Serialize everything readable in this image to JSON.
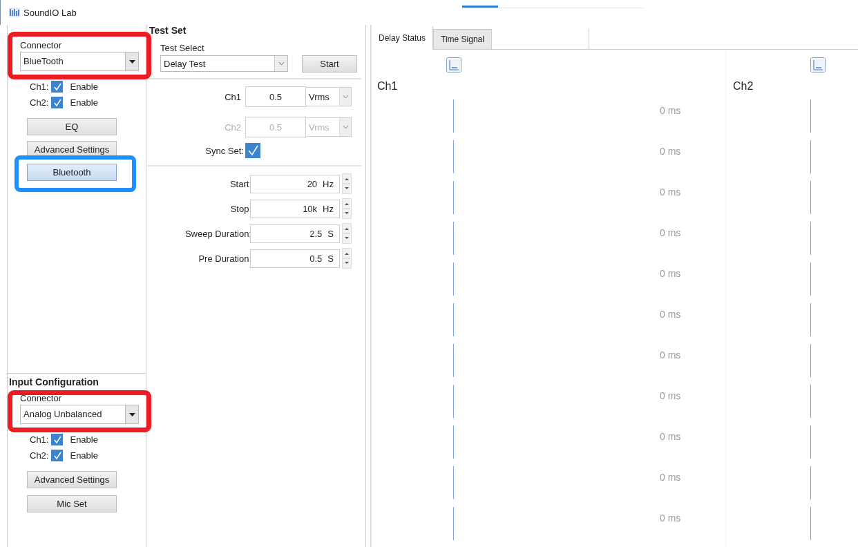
{
  "window": {
    "title": "SoundIO Lab"
  },
  "output": {
    "connector": {
      "label": "Connector",
      "value": "BlueTooth",
      "highlighted": true
    },
    "channels": [
      {
        "label": "Ch1:",
        "text": "Enable",
        "checked": true
      },
      {
        "label": "Ch2:",
        "text": "Enable",
        "checked": true
      }
    ],
    "buttons": [
      {
        "label": "EQ"
      },
      {
        "label": "Advanced Settings"
      },
      {
        "label": "Bluetooth",
        "highlighted": true
      }
    ]
  },
  "input": {
    "title": "Input Configuration",
    "connector": {
      "label": "Connector",
      "value": "Analog Unbalanced",
      "highlighted": true
    },
    "channels": [
      {
        "label": "Ch1:",
        "text": "Enable",
        "checked": true
      },
      {
        "label": "Ch2:",
        "text": "Enable",
        "checked": true
      }
    ],
    "buttons": [
      {
        "label": "Advanced Settings"
      },
      {
        "label": "Mic Set"
      }
    ]
  },
  "test_set": {
    "title": "Test Set",
    "select_label": "Test Select",
    "select_value": "Delay Test",
    "start_button": "Start",
    "levels": [
      {
        "label": "Ch1",
        "value": "0.5",
        "unit": "Vrms",
        "disabled": false
      },
      {
        "label": "Ch2",
        "value": "0.5",
        "unit": "Vrms",
        "disabled": true
      }
    ],
    "sync": {
      "label": "Sync Set:",
      "checked": true
    },
    "params": [
      {
        "label": "Start:",
        "value": "20",
        "unit": "Hz"
      },
      {
        "label": "Stop:",
        "value": "10k",
        "unit": "Hz"
      },
      {
        "label": "Sweep Duration:",
        "value": "2.5",
        "unit": "S"
      },
      {
        "label": "Pre Duration:",
        "value": "0.5",
        "unit": "S"
      }
    ]
  },
  "tabs": [
    {
      "label": "Delay Status",
      "selected": true
    },
    {
      "label": "Time Signal",
      "selected": false
    }
  ],
  "channels": [
    {
      "label": "Ch1",
      "readings": [
        "0 ms",
        "0 ms",
        "0 ms",
        "0 ms",
        "0 ms",
        "0 ms",
        "0 ms",
        "0 ms",
        "0 ms",
        "0 ms",
        "0 ms"
      ]
    },
    {
      "label": "Ch2"
    }
  ]
}
